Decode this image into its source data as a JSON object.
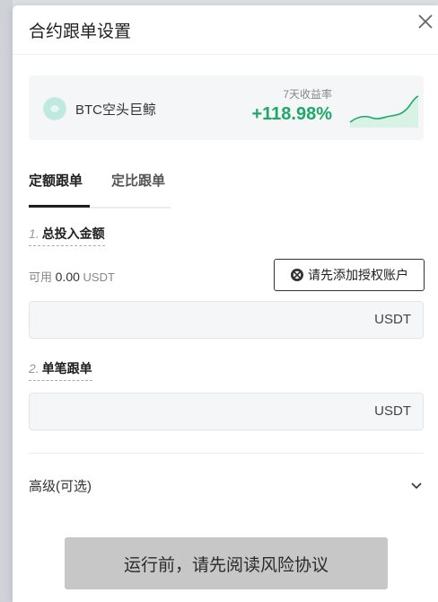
{
  "modal": {
    "title": "合约跟单设置"
  },
  "trader": {
    "name": "BTC空头巨鲸",
    "roi_label": "7天收益率",
    "roi_value": "+118.98%",
    "roi_color": "#1fa86a"
  },
  "tabs": [
    {
      "label": "定额跟单",
      "active": true
    },
    {
      "label": "定比跟单",
      "active": false
    }
  ],
  "total_investment": {
    "index": "1.",
    "label": "总投入金额",
    "available_label": "可用",
    "available_amount": "0.00",
    "available_unit": "USDT",
    "auth_button": "请先添加授权账户",
    "input_value": "",
    "unit": "USDT"
  },
  "per_order": {
    "index": "2.",
    "label": "单笔跟单",
    "input_value": "",
    "unit": "USDT"
  },
  "advanced": {
    "label": "高级(可选)"
  },
  "submit_button": "运行前，请先阅读风险协议"
}
